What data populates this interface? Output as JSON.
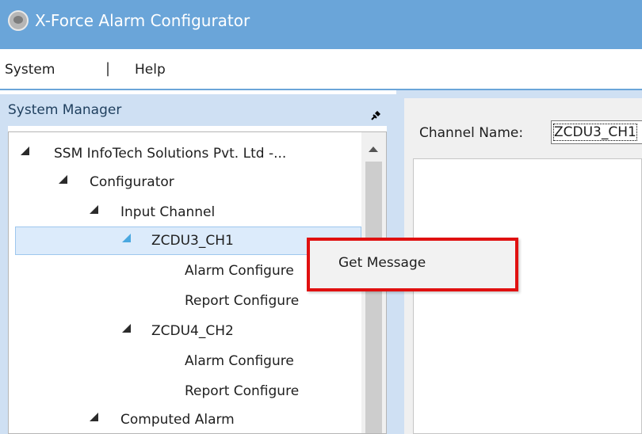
{
  "window": {
    "title": "X-Force Alarm Configurator",
    "accent_color": "#6aa5d9"
  },
  "menu": {
    "items": [
      "System",
      "Help"
    ],
    "separator": "|"
  },
  "system_manager": {
    "title": "System Manager",
    "pin_icon": "pin-icon",
    "tree": [
      {
        "label": "SSM InfoTech Solutions Pvt. Ltd -...",
        "level": 0,
        "expanded": true
      },
      {
        "label": "Configurator",
        "level": 1,
        "expanded": true
      },
      {
        "label": "Input Channel",
        "level": 2,
        "expanded": true
      },
      {
        "label": "ZCDU3_CH1",
        "level": 3,
        "expanded": true,
        "selected": true
      },
      {
        "label": "Alarm Configure",
        "level": 4
      },
      {
        "label": "Report Configure",
        "level": 4
      },
      {
        "label": "ZCDU4_CH2",
        "level": 3,
        "expanded": true
      },
      {
        "label": "Alarm Configure",
        "level": 4
      },
      {
        "label": "Report Configure",
        "level": 4
      },
      {
        "label": "Computed Alarm",
        "level": 2,
        "expanded": true
      }
    ]
  },
  "right_panel": {
    "channel_name_label": "Channel Name:",
    "channel_name_value": "ZCDU3_CH1"
  },
  "context_menu": {
    "items": [
      "Get Message"
    ],
    "highlight_color": "#e01010"
  }
}
